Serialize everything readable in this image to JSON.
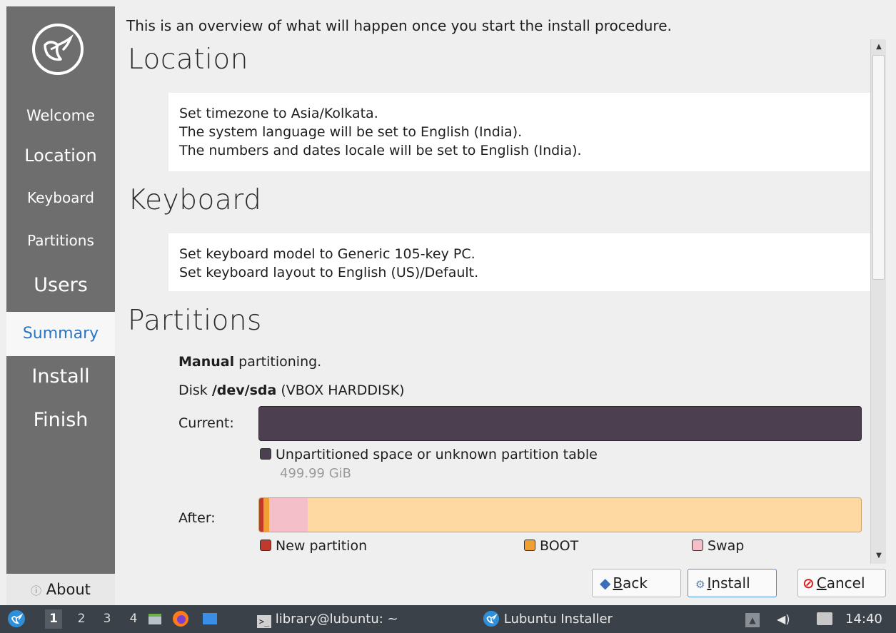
{
  "sidebar": {
    "logo_icon": "lubuntu-bird-icon",
    "items": [
      {
        "label": "Welcome"
      },
      {
        "label": "Location"
      },
      {
        "label": "Keyboard"
      },
      {
        "label": "Partitions"
      },
      {
        "label": "Users"
      },
      {
        "label": "Summary"
      },
      {
        "label": "Install"
      },
      {
        "label": "Finish"
      }
    ],
    "active_item": "Summary",
    "about_label": "About",
    "about_icon": "info-icon"
  },
  "intro_text": "This is an overview of what will happen once you start the install procedure.",
  "sections": {
    "location": {
      "title": "Location",
      "lines": [
        "Set timezone to Asia/Kolkata.",
        "The system language will be set to English (India).",
        "The numbers and dates locale will be set to English (India)."
      ]
    },
    "keyboard": {
      "title": "Keyboard",
      "lines": [
        "Set keyboard model to Generic 105-key PC.",
        "Set keyboard layout to English (US)/Default."
      ]
    },
    "partitions": {
      "title": "Partitions",
      "manual_bold": "Manual",
      "manual_rest": " partitioning.",
      "disk_prefix": "Disk ",
      "disk_bold": "/dev/sda",
      "disk_rest": " (VBOX HARDDISK)",
      "current_label": "Current:",
      "current_legend": "Unpartitioned space or unknown partition table",
      "current_size": "499.99 GiB",
      "after_label": "After:",
      "after_legend": [
        {
          "label": "New partition",
          "color": "#c0392b"
        },
        {
          "label": "BOOT",
          "color": "#f0a030"
        },
        {
          "label": "Swap",
          "color": "#f4bfc8"
        }
      ],
      "colors": {
        "unpartitioned": "#4c3f4f",
        "free_after": "#fed9a1"
      }
    }
  },
  "buttons": {
    "back": {
      "pre": "",
      "u": "B",
      "post": "ack",
      "icon": "arrow-left-icon"
    },
    "install": {
      "pre": "",
      "u": "I",
      "post": "nstall",
      "icon": "install-gear-icon"
    },
    "cancel": {
      "pre": "",
      "u": "C",
      "post": "ancel",
      "icon": "cancel-icon"
    }
  },
  "taskbar": {
    "workspaces": [
      "1",
      "2",
      "3",
      "4"
    ],
    "active_workspace": "1",
    "terminal_task": "library@lubuntu: ~",
    "installer_task": "Lubuntu Installer",
    "clock": "14:40"
  }
}
